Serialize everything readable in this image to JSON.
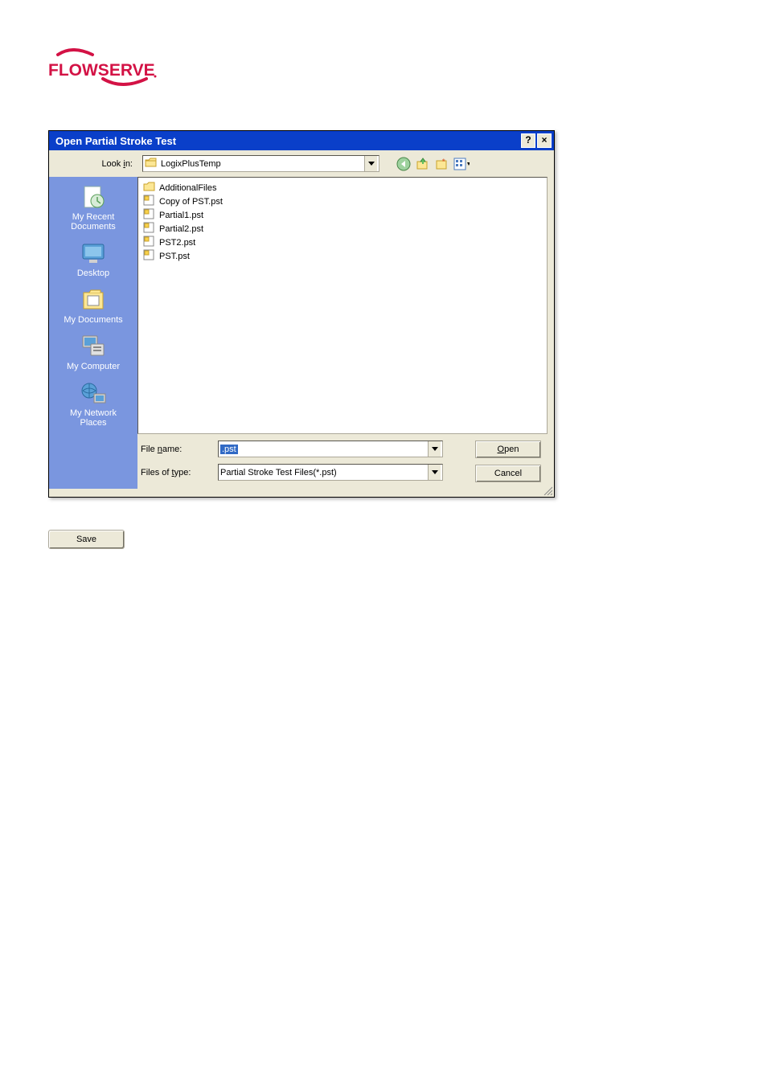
{
  "logo": {
    "text": "FLOWSERVE"
  },
  "dialog": {
    "title": "Open Partial Stroke Test",
    "help": "?",
    "close": "×",
    "lookin_label": "Look in:",
    "lookin_value": "LogixPlusTemp",
    "places": [
      {
        "label": "My Recent Documents",
        "icon": "recent"
      },
      {
        "label": "Desktop",
        "icon": "desktop"
      },
      {
        "label": "My Documents",
        "icon": "mydocs"
      },
      {
        "label": "My Computer",
        "icon": "mycomputer"
      },
      {
        "label": "My Network Places",
        "icon": "network"
      }
    ],
    "files": [
      {
        "name": "AdditionalFiles",
        "type": "folder"
      },
      {
        "name": "Copy of PST.pst",
        "type": "pst"
      },
      {
        "name": "Partial1.pst",
        "type": "pst"
      },
      {
        "name": "Partial2.pst",
        "type": "pst"
      },
      {
        "name": "PST2.pst",
        "type": "pst"
      },
      {
        "name": "PST.pst",
        "type": "pst"
      }
    ],
    "filename_label": "File name:",
    "filename_value": ".pst",
    "filetype_label": "Files of type:",
    "filetype_value": "Partial Stroke Test Files(*.pst)",
    "open_btn": "Open",
    "cancel_btn": "Cancel"
  },
  "save_button": "Save"
}
